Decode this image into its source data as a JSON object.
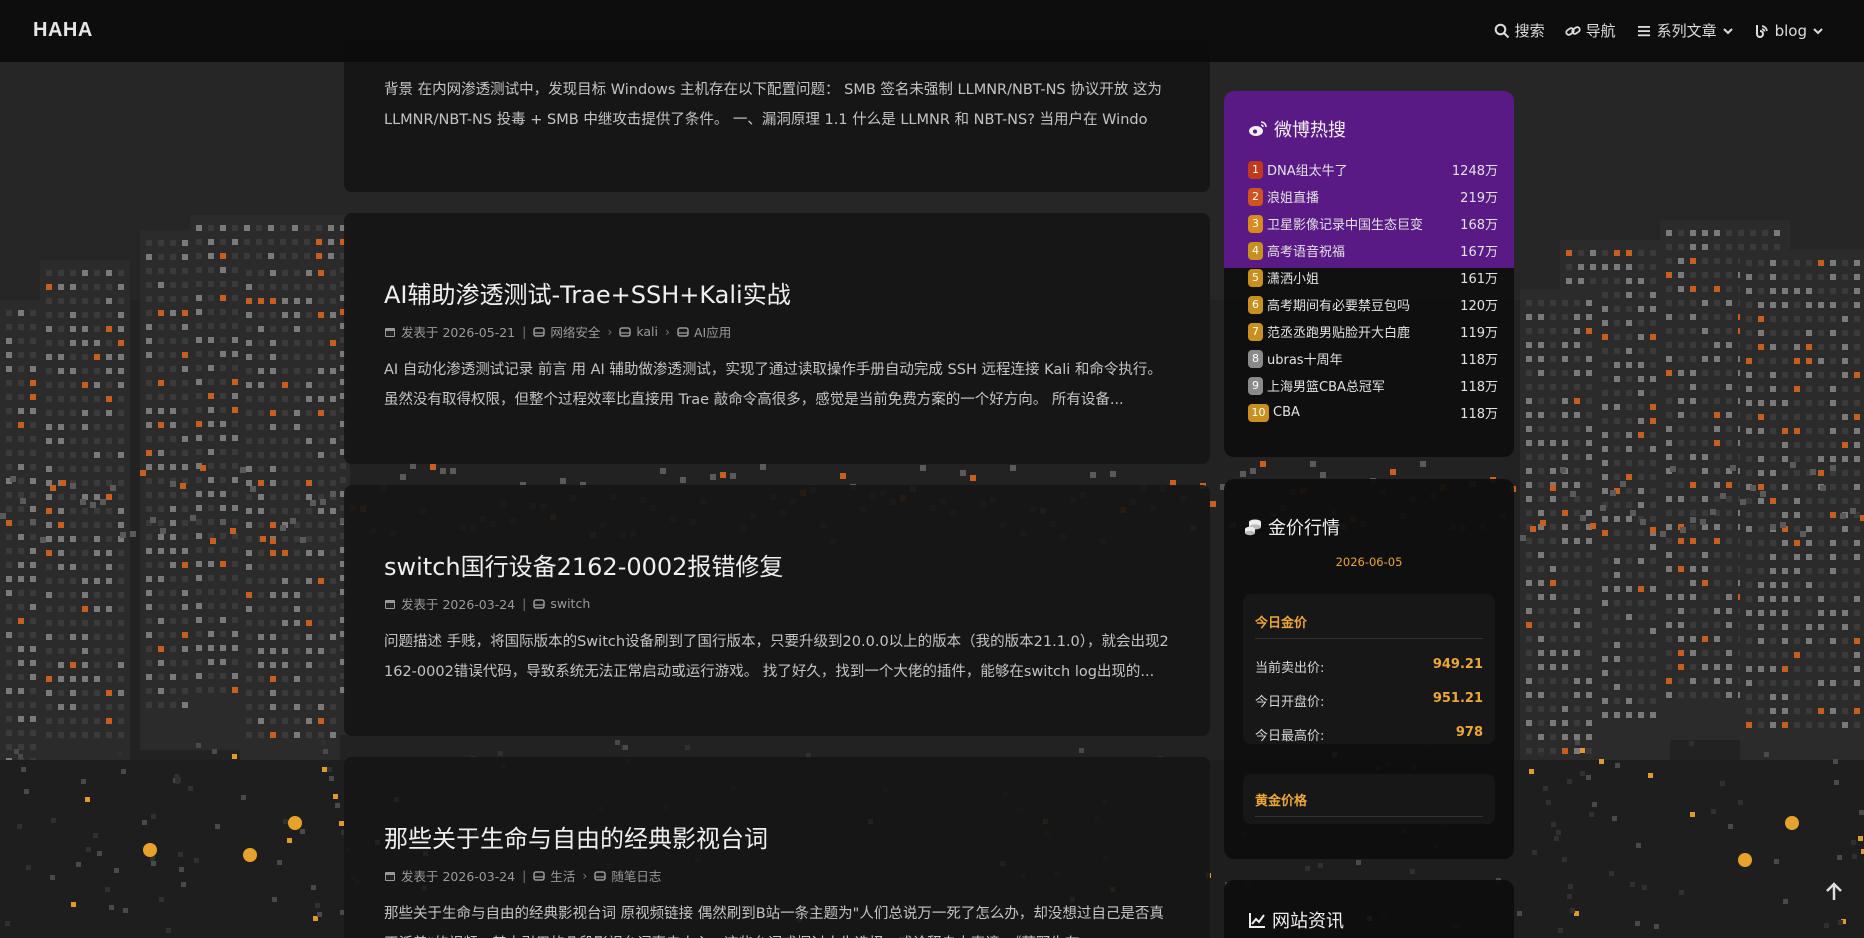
{
  "brand": "HAHA",
  "nav": {
    "search": "搜索",
    "guide": "导航",
    "series": "系列文章",
    "blog": "blog"
  },
  "posts": [
    {
      "title": "",
      "excerpt": "背景 在内网渗透测试中，发现目标 Windows 主机存在以下配置问题： SMB 签名未强制 LLMNR/NBT-NS 协议开放 这为 LLMNR/NBT-NS 投毒 + SMB 中继攻击提供了条件。 一、漏洞原理 1.1 什么是 LLMNR 和 NBT-NS? 当用户在 Window..."
    },
    {
      "title": "AI辅助渗透测试-Trae+SSH+Kali实战",
      "date": "发表于 2026-05-21",
      "categories": [
        "网络安全",
        "kali",
        "AI应用"
      ],
      "excerpt": "AI 自动化渗透测试记录 前言 用 AI 辅助做渗透测试，实现了通过读取操作手册自动完成 SSH 远程连接 Kali 和命令执行。虽然没有取得权限，但整个过程效率比直接用 Trae 敲命令高很多，感觉是当前免费方案的一个好方向。 所有设备..."
    },
    {
      "title": "switch国行设备2162-0002报错修复",
      "date": "发表于 2026-03-24",
      "categories": [
        "switch"
      ],
      "excerpt": "问题描述 手贱，将国际版本的Switch设备刷到了国行版本，只要升级到20.0.0以上的版本（我的版本21.1.0），就会出现2162-0002错误代码，导致系统无法正常启动或运行游戏。 找了好久，找到一个大佬的插件，能够在switch log出现的..."
    },
    {
      "title": "那些关于生命与自由的经典影视台词",
      "date": "发表于 2026-03-24",
      "categories": [
        "生活",
        "随笔日志"
      ],
      "excerpt": "那些关于生命与自由的经典影视台词 原视频链接 偶然刷到B站一条主题为\"人们总说万一死了怎么办，却没想过自己是否真正活着\"的视频，其中引用的几段影视台词直击人心。这些台词或探讨人生选择，或诠释自由真谛：《荒野生存..."
    }
  ],
  "weibo": {
    "title": "微博热搜",
    "items": [
      {
        "rank": "1",
        "text": "DNA组太牛了",
        "heat": "1248万"
      },
      {
        "rank": "2",
        "text": "浪姐直播",
        "heat": "219万"
      },
      {
        "rank": "3",
        "text": "卫星影像记录中国生态巨变",
        "heat": "168万"
      },
      {
        "rank": "4",
        "text": "高考语音祝福",
        "heat": "167万"
      },
      {
        "rank": "5",
        "text": "潇洒小姐",
        "heat": "161万"
      },
      {
        "rank": "6",
        "text": "高考期间有必要禁豆包吗",
        "heat": "120万"
      },
      {
        "rank": "7",
        "text": "范丞丞跑男贴脸开大白鹿",
        "heat": "119万"
      },
      {
        "rank": "8",
        "text": "ubras十周年",
        "heat": "118万"
      },
      {
        "rank": "9",
        "text": "上海男篮CBA总冠军",
        "heat": "118万"
      },
      {
        "rank": "10",
        "text": "CBA",
        "heat": "118万"
      }
    ]
  },
  "gold": {
    "title": "金价行情",
    "date": "2026-06-05",
    "today_label": "今日金价",
    "rows": [
      {
        "label": "当前卖出价:",
        "value": "949.21"
      },
      {
        "label": "今日开盘价:",
        "value": "951.21"
      },
      {
        "label": "今日最高价:",
        "value": "978"
      }
    ],
    "price_label": "黄金价格"
  },
  "site": {
    "title": "网站资讯"
  },
  "colors": {
    "accent": "#eca63a",
    "weibo_purple": "#5a1a86",
    "card": "#161616"
  }
}
